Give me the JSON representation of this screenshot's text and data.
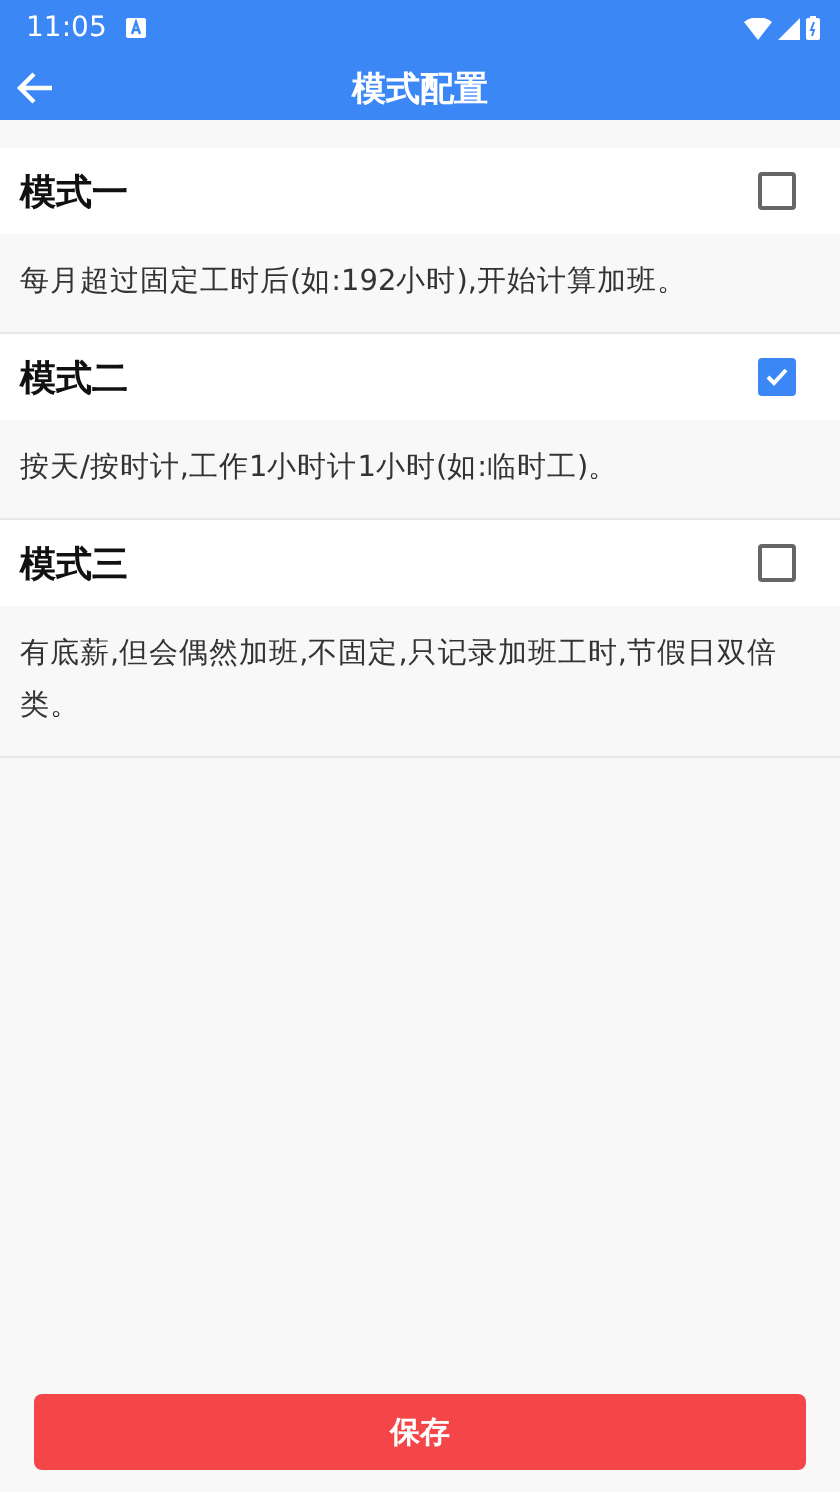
{
  "status_bar": {
    "time": "11:05"
  },
  "app_bar": {
    "title": "模式配置"
  },
  "modes": [
    {
      "title": "模式一",
      "checked": false,
      "description": "每月超过固定工时后(如:192小时),开始计算加班。"
    },
    {
      "title": "模式二",
      "checked": true,
      "description": "按天/按时计,工作1小时计1小时(如:临时工)。"
    },
    {
      "title": "模式三",
      "checked": false,
      "description": "有底薪,但会偶然加班,不固定,只记录加班工时,节假日双倍类。"
    }
  ],
  "save_button": {
    "label": "保存"
  }
}
